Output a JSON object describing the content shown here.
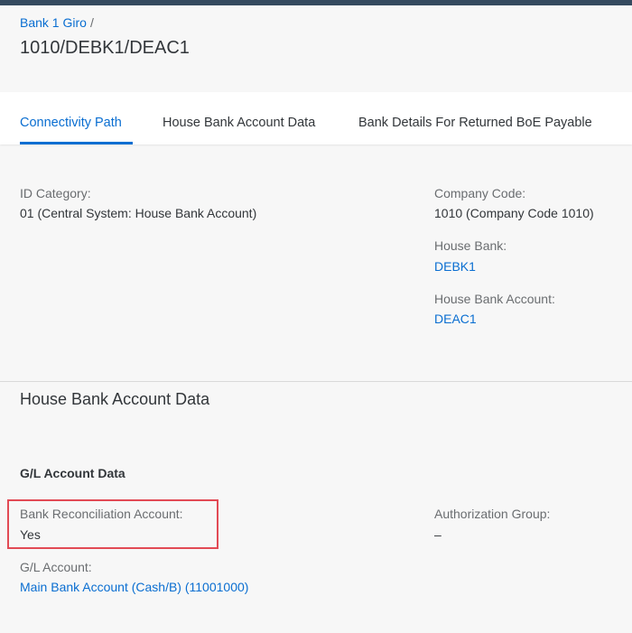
{
  "header": {
    "breadcrumb_link": "Bank 1 Giro",
    "breadcrumb_sep": "/",
    "title": "1010/DEBK1/DEAC1"
  },
  "tabs": [
    {
      "label": "Connectivity Path",
      "active": true
    },
    {
      "label": "House Bank Account Data",
      "active": false
    },
    {
      "label": "Bank Details For Returned BoE Payable",
      "active": false
    }
  ],
  "connectivity": {
    "id_category_label": "ID Category:",
    "id_category_value": "01 (Central System: House Bank Account)",
    "company_code_label": "Company Code:",
    "company_code_value": "1010 (Company Code 1010)",
    "house_bank_label": "House Bank:",
    "house_bank_value": "DEBK1",
    "house_bank_account_label": "House Bank Account:",
    "house_bank_account_value": "DEAC1"
  },
  "house_bank_account_data": {
    "section_title": "House Bank Account Data",
    "subsection_title": "G/L Account Data",
    "bank_recon_label": "Bank Reconciliation Account:",
    "bank_recon_value": "Yes",
    "auth_group_label": "Authorization Group:",
    "auth_group_value": "–",
    "gl_account_label": "G/L Account:",
    "gl_account_value": "Main Bank Account (Cash/B) (11001000)"
  },
  "colors": {
    "accent": "#0a6ed1",
    "shell": "#354a5f",
    "highlight_border": "#e24a55"
  }
}
